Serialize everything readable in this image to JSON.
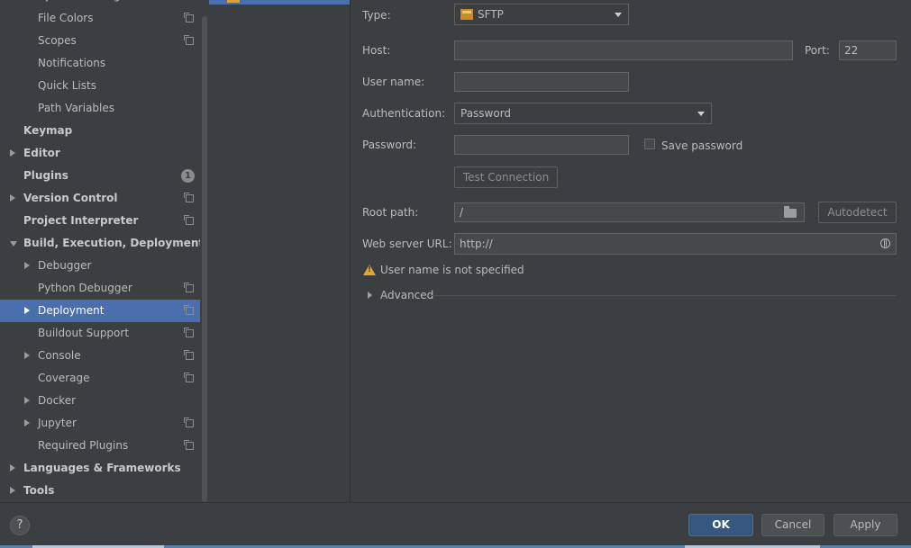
{
  "sidebar": {
    "items": [
      {
        "label": "System Settings",
        "level": 2,
        "arrow": "none",
        "icon": "copy",
        "bold": false,
        "selected": false
      },
      {
        "label": "File Colors",
        "level": 2,
        "arrow": "none",
        "icon": "copy",
        "bold": false,
        "selected": false
      },
      {
        "label": "Scopes",
        "level": 2,
        "arrow": "none",
        "icon": "copy",
        "bold": false,
        "selected": false
      },
      {
        "label": "Notifications",
        "level": 2,
        "arrow": "none",
        "icon": "none",
        "bold": false,
        "selected": false
      },
      {
        "label": "Quick Lists",
        "level": 2,
        "arrow": "none",
        "icon": "none",
        "bold": false,
        "selected": false
      },
      {
        "label": "Path Variables",
        "level": 2,
        "arrow": "none",
        "icon": "none",
        "bold": false,
        "selected": false
      },
      {
        "label": "Keymap",
        "level": 1,
        "arrow": "none",
        "icon": "none",
        "bold": true,
        "selected": false
      },
      {
        "label": "Editor",
        "level": 1,
        "arrow": "right",
        "icon": "none",
        "bold": true,
        "selected": false
      },
      {
        "label": "Plugins",
        "level": 1,
        "arrow": "none",
        "icon": "badge",
        "badge": "1",
        "bold": true,
        "selected": false
      },
      {
        "label": "Version Control",
        "level": 1,
        "arrow": "right",
        "icon": "copy",
        "bold": true,
        "selected": false
      },
      {
        "label": "Project Interpreter",
        "level": 1,
        "arrow": "none",
        "icon": "copy",
        "bold": true,
        "selected": false
      },
      {
        "label": "Build, Execution, Deployment",
        "level": 1,
        "arrow": "down",
        "icon": "none",
        "bold": true,
        "selected": false
      },
      {
        "label": "Debugger",
        "level": 2,
        "arrow": "right",
        "icon": "none",
        "bold": false,
        "selected": false
      },
      {
        "label": "Python Debugger",
        "level": 2,
        "arrow": "none",
        "icon": "copy",
        "bold": false,
        "selected": false
      },
      {
        "label": "Deployment",
        "level": 2,
        "arrow": "right",
        "icon": "copy",
        "bold": false,
        "selected": true
      },
      {
        "label": "Buildout Support",
        "level": 2,
        "arrow": "none",
        "icon": "copy",
        "bold": false,
        "selected": false
      },
      {
        "label": "Console",
        "level": 2,
        "arrow": "right",
        "icon": "copy",
        "bold": false,
        "selected": false
      },
      {
        "label": "Coverage",
        "level": 2,
        "arrow": "none",
        "icon": "copy",
        "bold": false,
        "selected": false
      },
      {
        "label": "Docker",
        "level": 2,
        "arrow": "right",
        "icon": "none",
        "bold": false,
        "selected": false
      },
      {
        "label": "Jupyter",
        "level": 2,
        "arrow": "right",
        "icon": "copy",
        "bold": false,
        "selected": false
      },
      {
        "label": "Required Plugins",
        "level": 2,
        "arrow": "none",
        "icon": "copy",
        "bold": false,
        "selected": false
      },
      {
        "label": "Languages & Frameworks",
        "level": 1,
        "arrow": "right",
        "icon": "none",
        "bold": true,
        "selected": false
      },
      {
        "label": "Tools",
        "level": 1,
        "arrow": "right",
        "icon": "none",
        "bold": true,
        "selected": false
      }
    ]
  },
  "form": {
    "type_label": "Type:",
    "type_value": "SFTP",
    "type_icon_text": "SFTP",
    "host_label": "Host:",
    "host_value": "",
    "port_label": "Port:",
    "port_value": "22",
    "username_label": "User name:",
    "username_value": "",
    "auth_label": "Authentication:",
    "auth_value": "Password",
    "password_label": "Password:",
    "password_value": "",
    "save_password_label": "Save password",
    "save_password_checked": false,
    "test_connection_label": "Test Connection",
    "root_path_label": "Root path:",
    "root_path_value": "/",
    "autodetect_label": "Autodetect",
    "web_url_label": "Web server URL:",
    "web_url_value": "http://",
    "warning_text": "User name is not specified",
    "advanced_label": "Advanced"
  },
  "footer": {
    "help_label": "?",
    "ok_label": "OK",
    "cancel_label": "Cancel",
    "apply_label": "Apply"
  },
  "colors": {
    "background": "#3c3f41",
    "selection": "#4b6eaf",
    "primary_button": "#365880",
    "warning": "#e0a82e"
  }
}
